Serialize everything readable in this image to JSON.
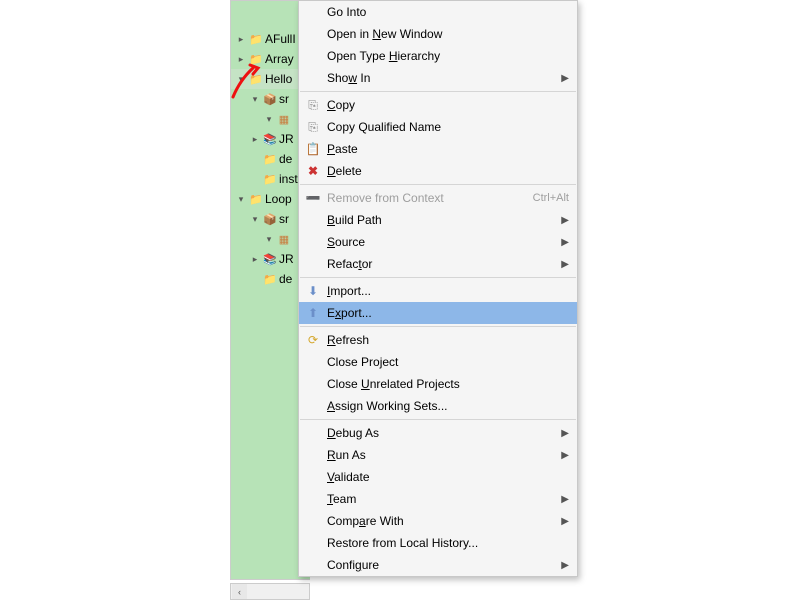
{
  "tree": {
    "items": [
      {
        "depth": 0,
        "expander": "closed",
        "icon": "folder",
        "label": "AFullI"
      },
      {
        "depth": 0,
        "expander": "closed",
        "icon": "folder",
        "label": "Array"
      },
      {
        "depth": 0,
        "expander": "open",
        "icon": "proj",
        "label": "Hello",
        "selected": true
      },
      {
        "depth": 1,
        "expander": "open",
        "icon": "src",
        "label": "sr"
      },
      {
        "depth": 2,
        "expander": "open",
        "icon": "pkg",
        "label": ""
      },
      {
        "depth": 1,
        "expander": "closed",
        "icon": "jre",
        "label": "JR"
      },
      {
        "depth": 1,
        "expander": "none",
        "icon": "folder",
        "label": "de"
      },
      {
        "depth": 1,
        "expander": "none",
        "icon": "folder",
        "label": "inst"
      },
      {
        "depth": 0,
        "expander": "open",
        "icon": "proj",
        "label": "Loop"
      },
      {
        "depth": 1,
        "expander": "open",
        "icon": "src",
        "label": "sr"
      },
      {
        "depth": 2,
        "expander": "open",
        "icon": "pkg",
        "label": ""
      },
      {
        "depth": 1,
        "expander": "closed",
        "icon": "jre",
        "label": "JR"
      },
      {
        "depth": 1,
        "expander": "none",
        "icon": "folder",
        "label": "de"
      }
    ]
  },
  "menu": {
    "groups": [
      [
        {
          "label": "Go Into"
        },
        {
          "label": "Open in New Window",
          "mn": "N"
        },
        {
          "label": "Open Type Hierarchy",
          "mn": "H"
        },
        {
          "label": "Show In",
          "mn": "w",
          "sub": true
        }
      ],
      [
        {
          "label": "Copy",
          "mn": "C",
          "icon": "copy"
        },
        {
          "label": "Copy Qualified Name",
          "icon": "copy"
        },
        {
          "label": "Paste",
          "mn": "P",
          "icon": "paste"
        },
        {
          "label": "Delete",
          "mn": "D",
          "icon": "delete"
        }
      ],
      [
        {
          "label": "Remove from Context",
          "disabled": true,
          "icon": "remove",
          "accel": "Ctrl+Alt"
        },
        {
          "label": "Build Path",
          "mn": "B",
          "sub": true
        },
        {
          "label": "Source",
          "mn": "S",
          "sub": true
        },
        {
          "label": "Refactor",
          "mn": "t",
          "sub": true
        }
      ],
      [
        {
          "label": "Import...",
          "mn": "I",
          "icon": "import"
        },
        {
          "label": "Export...",
          "mn": "x",
          "icon": "export",
          "hover": true
        }
      ],
      [
        {
          "label": "Refresh",
          "mn": "R",
          "icon": "refresh"
        },
        {
          "label": "Close Project"
        },
        {
          "label": "Close Unrelated Projects",
          "mn": "U"
        },
        {
          "label": "Assign Working Sets...",
          "mn": "A"
        }
      ],
      [
        {
          "label": "Debug As",
          "mn": "D",
          "sub": true
        },
        {
          "label": "Run As",
          "mn": "R",
          "sub": true
        },
        {
          "label": "Validate",
          "mn": "V"
        },
        {
          "label": "Team",
          "mn": "T",
          "sub": true
        },
        {
          "label": "Compare With",
          "mn": "a",
          "sub": true
        },
        {
          "label": "Restore from Local History..."
        },
        {
          "label": "Configure",
          "mn": "g",
          "sub": true
        }
      ]
    ]
  }
}
